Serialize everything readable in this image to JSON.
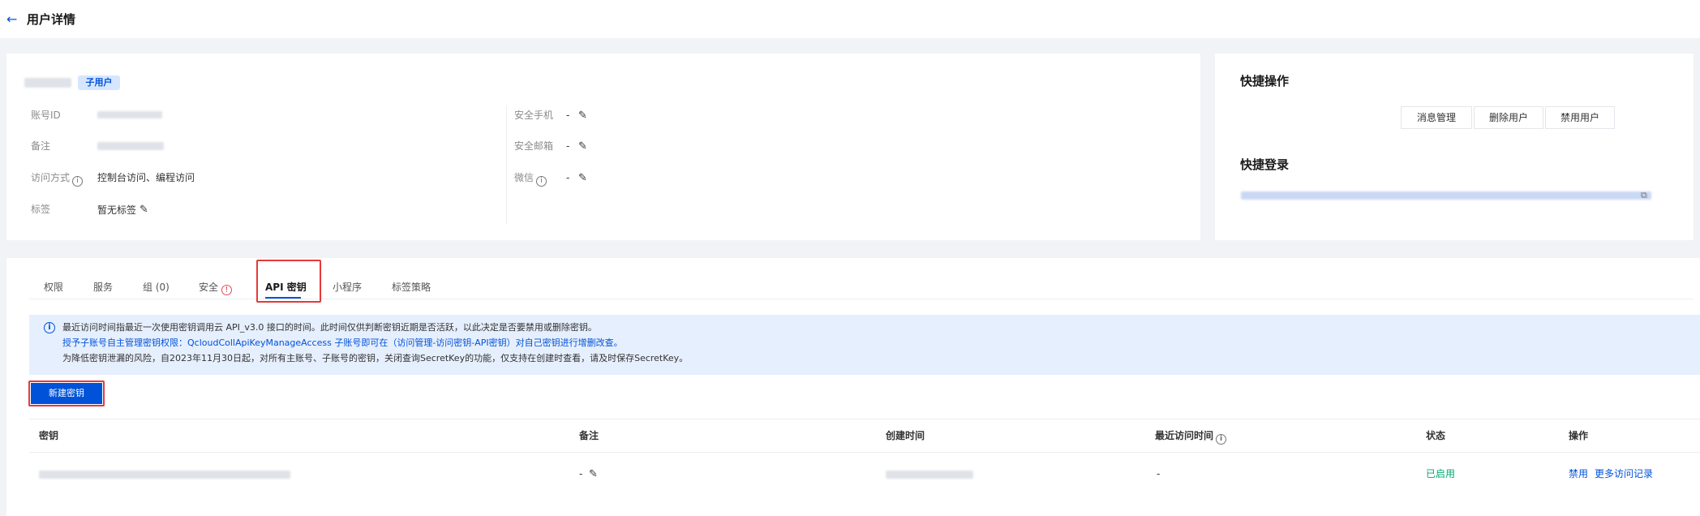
{
  "header": {
    "back_icon": "arrow-left-icon",
    "title": "用户详情"
  },
  "user": {
    "badge": "子用户",
    "fields_left": [
      {
        "label": "账号ID"
      },
      {
        "label": "备注"
      },
      {
        "label": "访问方式",
        "value": "控制台访问、编程访问"
      },
      {
        "label": "标签",
        "value": "暂无标签"
      }
    ],
    "fields_right": [
      {
        "label": "安全手机",
        "value": "-"
      },
      {
        "label": "安全邮箱",
        "value": "-"
      },
      {
        "label": "微信",
        "value": "-"
      }
    ]
  },
  "quick_actions": {
    "title": "快捷操作",
    "buttons": [
      "消息管理",
      "删除用户",
      "禁用用户"
    ],
    "login_title": "快捷登录"
  },
  "tabs": [
    "权限",
    "服务",
    "组 (0)",
    "安全",
    "API 密钥",
    "小程序",
    "标签策略"
  ],
  "active_tab": "API 密钥",
  "notice": {
    "icon": "info-icon",
    "line1": "最近访问时间指最近一次使用密钥调用云 API_v3.0 接口的时间。此时间仅供判断密钥近期是否活跃，以此决定是否要禁用或删除密钥。",
    "line2": "授予子账号自主管理密钥权限：QcloudCollApiKeyManageAccess 子账号即可在（访问管理-访问密钥-API密钥）对自己密钥进行增删改查。",
    "line3": "为降低密钥泄漏的风险，自2023年11月30日起，对所有主账号、子账号的密钥，关闭查询SecretKey的功能，仅支持在创建时查看，请及时保存SecretKey。"
  },
  "create_button": "新建密钥",
  "table": {
    "headers": [
      "密钥",
      "备注",
      "创建时间",
      "最近访问时间",
      "状态",
      "操作"
    ],
    "rows": [
      {
        "remark": "-",
        "last_access": "-",
        "status": "已启用",
        "actions": [
          "禁用",
          "更多访问记录"
        ]
      }
    ]
  },
  "colors": {
    "primary": "#0052d9",
    "success": "#00a870",
    "danger": "#e34d59",
    "highlight": "#e5393a"
  }
}
